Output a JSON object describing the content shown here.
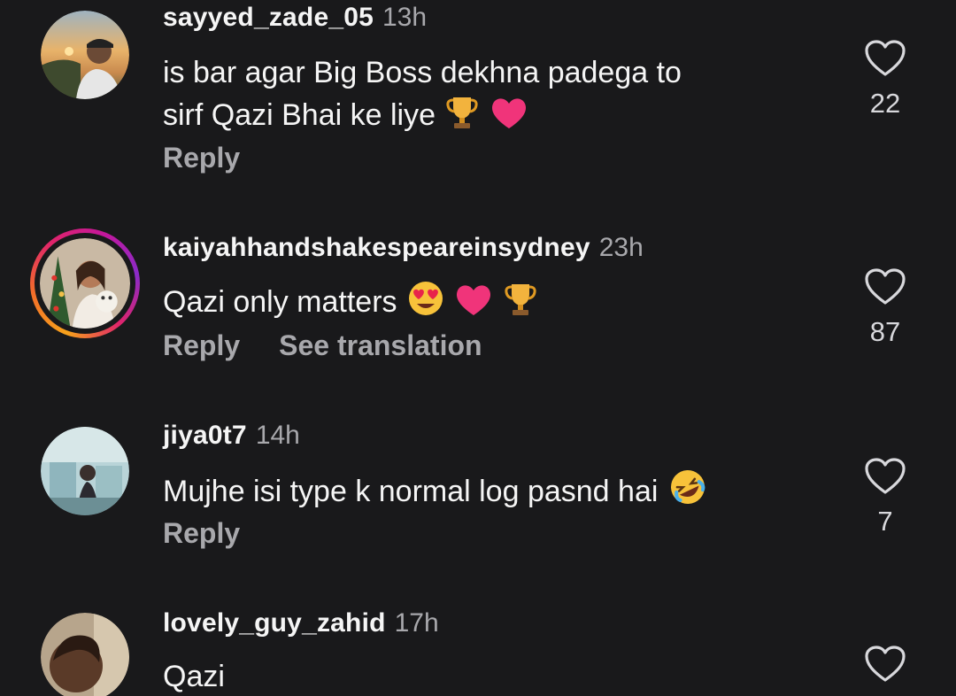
{
  "comments": [
    {
      "username": "sayyed_zade_05",
      "time": "13h",
      "text_line1": "is bar agar Big Boss dekhna padega to",
      "text_line2": "sirf Qazi Bhai ke liye",
      "emojis": [
        "trophy",
        "pink-heart"
      ],
      "reply_label": "Reply",
      "likes": "22",
      "avatar_icon": "avatar-sunset-photo"
    },
    {
      "username": "kaiyahhandshakespeareinsydney",
      "time": "23h",
      "text_line1": "Qazi only matters",
      "emojis": [
        "heart-eyes",
        "pink-heart",
        "trophy"
      ],
      "reply_label": "Reply",
      "translation_label": "See translation",
      "likes": "87",
      "has_story": true,
      "avatar_icon": "avatar-christmas-photo"
    },
    {
      "username": "jiya0t7",
      "time": "14h",
      "text_line1": "Mujhe isi type k normal log pasnd hai",
      "emojis": [
        "rolling-laughing"
      ],
      "reply_label": "Reply",
      "likes": "7",
      "avatar_icon": "avatar-room-photo"
    },
    {
      "username": "lovely_guy_zahid",
      "time": "17h",
      "text_line1": "Qazi",
      "likes": "",
      "avatar_icon": "avatar-face-photo"
    }
  ],
  "colors": {
    "background": "#19191b",
    "primary_text": "#f5f5f5",
    "secondary_text": "#a8a8ac",
    "heart_emoji": "#f0347a",
    "trophy": "#f2b33d"
  }
}
